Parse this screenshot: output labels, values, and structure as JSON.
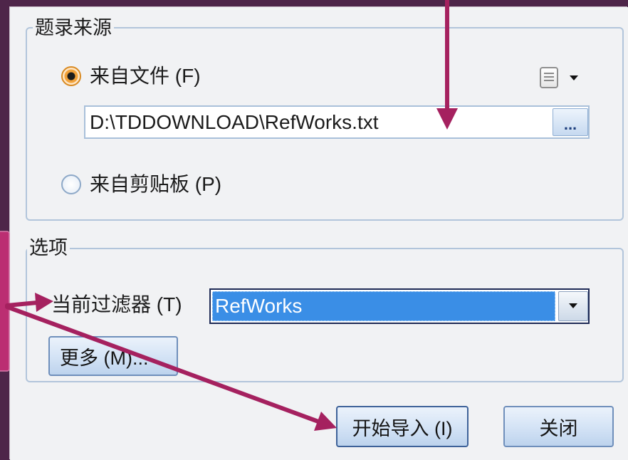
{
  "dialog": {
    "source_group": {
      "title": "题录来源",
      "from_file": {
        "label": "来自文件 (F)",
        "selected": true
      },
      "file_path": "D:\\TDDOWNLOAD\\RefWorks.txt",
      "browse_label": "...",
      "from_clipboard": {
        "label": "来自剪贴板 (P)",
        "selected": false
      },
      "file_options_icon": "document-icon",
      "file_options_dropdown_icon": "caret-down-icon"
    },
    "options_group": {
      "title": "选项",
      "filter_label": "当前过滤器 (T)",
      "filter_value": "RefWorks",
      "filter_dropdown_icon": "caret-down-icon",
      "more_label": "更多 (M)..."
    },
    "buttons": {
      "start_import": "开始导入 (I)",
      "close": "关闭"
    }
  },
  "colors": {
    "slide_background": "#4e2549",
    "annotation_arrow": "#a5215f",
    "annotation_callout": "#bb2e72",
    "selection": "#3a8ee6",
    "radio_selected": "#f2a23a",
    "dialog_background": "#f1f2f4"
  }
}
